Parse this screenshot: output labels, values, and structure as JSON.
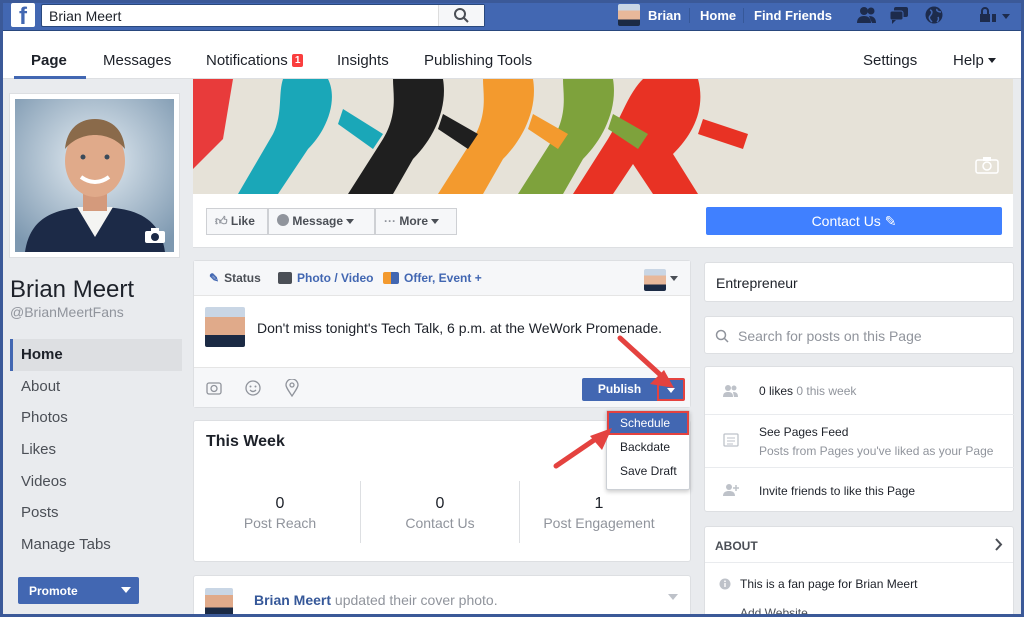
{
  "topbar": {
    "search_value": "Brian Meert",
    "user_name": "Brian",
    "home": "Home",
    "find_friends": "Find Friends"
  },
  "tabs": {
    "page": "Page",
    "messages": "Messages",
    "notifications": "Notifications",
    "notifications_count": "1",
    "insights": "Insights",
    "publishing_tools": "Publishing Tools",
    "settings": "Settings",
    "help": "Help"
  },
  "profile": {
    "name": "Brian Meert",
    "handle": "@BrianMeertFans"
  },
  "leftnav": {
    "items": [
      "Home",
      "About",
      "Photos",
      "Likes",
      "Videos",
      "Posts",
      "Manage Tabs"
    ],
    "promote": "Promote"
  },
  "actions": {
    "like": "Like",
    "message": "Message",
    "more": "More",
    "contact": "Contact Us"
  },
  "composer": {
    "status": "Status",
    "photo_video": "Photo / Video",
    "offer_event": "Offer, Event +",
    "text": "Don't miss tonight's Tech Talk, 6 p.m. at the WeWork Promenade.",
    "publish": "Publish",
    "menu": [
      "Schedule",
      "Backdate",
      "Save Draft"
    ]
  },
  "this_week": {
    "title": "This Week",
    "stats": [
      {
        "value": "0",
        "label": "Post Reach"
      },
      {
        "value": "0",
        "label": "Contact Us"
      },
      {
        "value": "1",
        "label": "Post Engagement"
      }
    ]
  },
  "post": {
    "author": "Brian Meert",
    "action": "updated their cover photo."
  },
  "right": {
    "category": "Entrepreneur",
    "search_placeholder": "Search for posts on this Page",
    "likes": "0 likes",
    "likes_week": "0 this week",
    "pages_feed": "See Pages Feed",
    "pages_feed_sub": "Posts from Pages you've liked as your Page",
    "invite": "Invite friends to like this Page",
    "about_title": "ABOUT",
    "about_text": "This is a fan page for Brian Meert",
    "about_next": "Add Website"
  },
  "colors": {
    "brand": "#4267b2",
    "contact": "#4080ff",
    "highlight": "#e4423f"
  }
}
